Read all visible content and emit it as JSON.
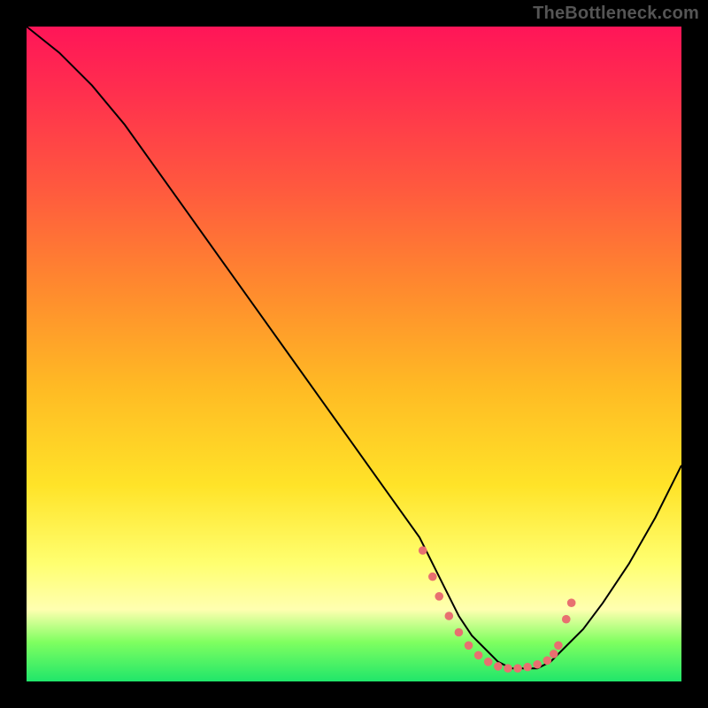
{
  "watermark": "TheBottleneck.com",
  "chart_data": {
    "type": "line",
    "title": "",
    "xlabel": "",
    "ylabel": "",
    "xlim": [
      0,
      100
    ],
    "ylim": [
      0,
      100
    ],
    "series": [
      {
        "name": "curve",
        "x": [
          0,
          5,
          10,
          15,
          20,
          25,
          30,
          35,
          40,
          45,
          50,
          55,
          60,
          62,
          64,
          66,
          68,
          70,
          72,
          74,
          76,
          78,
          80,
          82,
          85,
          88,
          92,
          96,
          100
        ],
        "y": [
          100,
          96,
          91,
          85,
          78,
          71,
          64,
          57,
          50,
          43,
          36,
          29,
          22,
          18,
          14,
          10,
          7,
          5,
          3,
          2,
          2,
          2,
          3,
          5,
          8,
          12,
          18,
          25,
          33
        ]
      }
    ],
    "markers": {
      "name": "dotted-valley",
      "color": "#e87070",
      "x": [
        60.5,
        62,
        63,
        64.5,
        66,
        67.5,
        69,
        70.5,
        72,
        73.5,
        75,
        76.5,
        78,
        79.5,
        80.5,
        81.2,
        82.4,
        83.2
      ],
      "y": [
        20,
        16,
        13,
        10,
        7.5,
        5.5,
        4,
        3,
        2.3,
        2,
        2,
        2.2,
        2.6,
        3.2,
        4.2,
        5.5,
        9.5,
        12
      ]
    },
    "gradient_stops": [
      {
        "pos": 0.0,
        "color": "#ff1558"
      },
      {
        "pos": 0.1,
        "color": "#ff2f4e"
      },
      {
        "pos": 0.25,
        "color": "#ff5a3e"
      },
      {
        "pos": 0.4,
        "color": "#ff8a2e"
      },
      {
        "pos": 0.55,
        "color": "#ffba24"
      },
      {
        "pos": 0.7,
        "color": "#ffe328"
      },
      {
        "pos": 0.82,
        "color": "#ffff70"
      },
      {
        "pos": 0.89,
        "color": "#ffffb0"
      },
      {
        "pos": 0.94,
        "color": "#7fff60"
      },
      {
        "pos": 1.0,
        "color": "#20e66a"
      }
    ]
  }
}
